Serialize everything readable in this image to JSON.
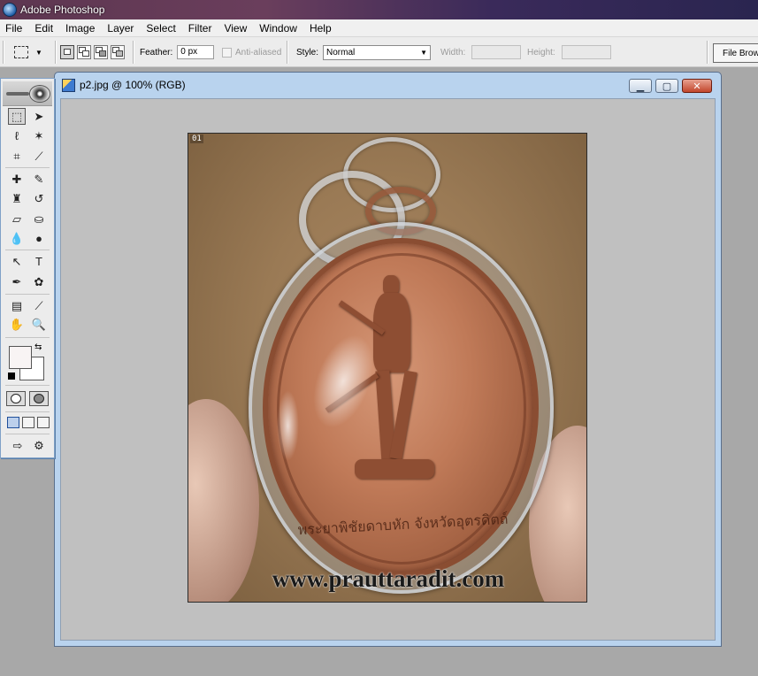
{
  "app": {
    "title": "Adobe Photoshop",
    "menu": [
      "File",
      "Edit",
      "Image",
      "Layer",
      "Select",
      "Filter",
      "View",
      "Window",
      "Help"
    ]
  },
  "options_bar": {
    "feather_label": "Feather:",
    "feather_value": "0 px",
    "antialiased_label": "Anti-aliased",
    "style_label": "Style:",
    "style_value": "Normal",
    "width_label": "Width:",
    "height_label": "Height:",
    "file_browser_label": "File Brow"
  },
  "toolbox": {
    "tools": [
      {
        "name": "marquee-tool",
        "glyph": "⬚"
      },
      {
        "name": "move-tool",
        "glyph": "➤"
      },
      {
        "name": "lasso-tool",
        "glyph": "ℓ"
      },
      {
        "name": "magic-wand-tool",
        "glyph": "✶"
      },
      {
        "name": "crop-tool",
        "glyph": "⌗"
      },
      {
        "name": "slice-tool",
        "glyph": "⟋"
      },
      {
        "name": "healing-brush-tool",
        "glyph": "✚"
      },
      {
        "name": "brush-tool",
        "glyph": "✎"
      },
      {
        "name": "clone-stamp-tool",
        "glyph": "♜"
      },
      {
        "name": "history-brush-tool",
        "glyph": "↺"
      },
      {
        "name": "eraser-tool",
        "glyph": "▱"
      },
      {
        "name": "paint-bucket-tool",
        "glyph": "⛀"
      },
      {
        "name": "blur-tool",
        "glyph": "💧"
      },
      {
        "name": "dodge-tool",
        "glyph": "●"
      },
      {
        "name": "path-selection-tool",
        "glyph": "↖"
      },
      {
        "name": "type-tool",
        "glyph": "T"
      },
      {
        "name": "pen-tool",
        "glyph": "✒"
      },
      {
        "name": "custom-shape-tool",
        "glyph": "✿"
      },
      {
        "name": "notes-tool",
        "glyph": "▤"
      },
      {
        "name": "eyedropper-tool",
        "glyph": "⟋"
      },
      {
        "name": "hand-tool",
        "glyph": "✋"
      },
      {
        "name": "zoom-tool",
        "glyph": "🔍"
      }
    ],
    "foreground_color": "#f8f4f4",
    "background_color": "#ffffff"
  },
  "document": {
    "title": "p2.jpg @ 100% (RGB)",
    "image_badge": "01",
    "watermark": "www.prauttaradit.com",
    "inscription": "พระยาพิชัยดาบหัก จังหวัดอุตรดิตถ์"
  },
  "colors": {
    "titlebar_accent": "#6a3e5c",
    "doc_frame": "#b9d3ee",
    "canvas_bg": "#c0c0c0"
  }
}
